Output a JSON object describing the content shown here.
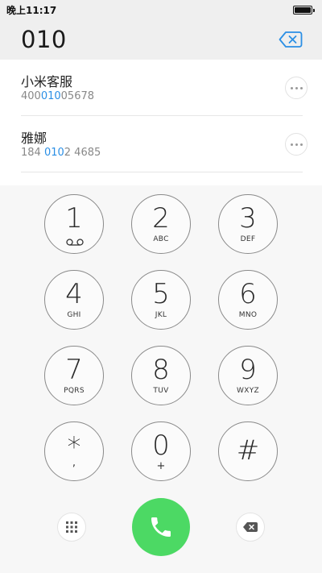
{
  "status_bar": {
    "time": "晚上11:17"
  },
  "dialer": {
    "number": "010"
  },
  "suggestions": [
    {
      "name": "小米客服",
      "number_pre": "400",
      "number_hl": "010",
      "number_post": "05678"
    },
    {
      "name": "雅娜",
      "number_pre": "184 ",
      "number_hl": "010",
      "number_post": "2 4685"
    }
  ],
  "keypad": {
    "keys": [
      {
        "digit": "1",
        "letters": "",
        "sub": "voicemail-icon"
      },
      {
        "digit": "2",
        "letters": "ABC"
      },
      {
        "digit": "3",
        "letters": "DEF"
      },
      {
        "digit": "4",
        "letters": "GHI"
      },
      {
        "digit": "5",
        "letters": "JKL"
      },
      {
        "digit": "6",
        "letters": "MNO"
      },
      {
        "digit": "7",
        "letters": "PQRS"
      },
      {
        "digit": "8",
        "letters": "TUV"
      },
      {
        "digit": "9",
        "letters": "WXYZ"
      },
      {
        "digit": "*",
        "letters": "",
        "sub": ","
      },
      {
        "digit": "0",
        "letters": "",
        "sub": "+"
      },
      {
        "digit": "#",
        "letters": ""
      }
    ]
  },
  "colors": {
    "accent_blue": "#2b8fe5",
    "call_green": "#4cd964",
    "header_bg": "#efefef"
  },
  "icons": {
    "backspace_top": "backspace-icon",
    "keypad_toggle": "keypad-grid-icon",
    "call": "phone-icon",
    "backspace_bottom": "backspace-icon",
    "more": "more-dots-icon"
  }
}
